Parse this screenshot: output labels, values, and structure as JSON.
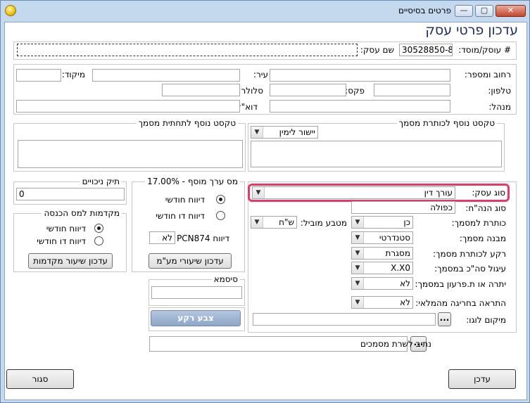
{
  "window": {
    "title": "פרטים בסיסיים",
    "close_glyph": "✕",
    "max_glyph": "▢",
    "min_glyph": "—"
  },
  "header": {
    "title": "עדכון פרטי עסק"
  },
  "business": {
    "id_label": "# עוסק/מוסד:",
    "id_value": "30528850-8",
    "name_label": "שם עסק:",
    "name_value": ""
  },
  "address": {
    "street_label": "רחוב ומספר:",
    "city_label": "עיר:",
    "zip_label": "מיקוד:",
    "phone_label": "טלפון:",
    "fax_label": "פקס:",
    "mobile_label": "סלולר:",
    "manager_label": "מנהל:",
    "email_label": "דוא\"ל:"
  },
  "footer_text": {
    "title": "טקסט נוסף לתחתית מסמך"
  },
  "header_text": {
    "title": "טקסט נוסף לכותרת מסמך",
    "align_value": "יישור לימין"
  },
  "vat": {
    "title": "מס ערך מוסף - 17.00%",
    "monthly_label": "דיווח חודשי",
    "bimonthly_label": "דיווח דו חודשי",
    "pcn_label": "דיווח PCN874",
    "pcn_value": "לא",
    "update_button": "עדכון שיעורי מע\"מ"
  },
  "deductions": {
    "title": "תיק ניכויים",
    "value": "0"
  },
  "advances": {
    "title": "מקדמות למס הכנסה",
    "monthly_label": "דיווח חודשי",
    "bimonthly_label": "דיווח דו חודשי",
    "update_button": "עדכון שיעור מקדמות"
  },
  "password": {
    "title": "סיסמא",
    "value": ""
  },
  "paint_button": "צבע רקע",
  "doc_settings": {
    "business_type_label": "סוג עסק:",
    "business_type_value": "עורך דין",
    "bookkeeping_label": "סוג הנה\"ח:",
    "bookkeeping_value": "כפולה",
    "doc_header_label": "כותרת למסמך:",
    "doc_header_value": "כן",
    "currency_label": "מטבע מוביל:",
    "currency_value": "ש\"ח",
    "doc_structure_label": "מבנה מסמך:",
    "doc_structure_value": "סטנדרטי",
    "header_bg_label": "רקע לכותרת מסמך:",
    "header_bg_value": "מסגרת",
    "rounding_label": "עיגול סה\"כ במסמך:",
    "rounding_value": "X.X0",
    "balance_label": "יתרה או ת.פרעון במסמך:",
    "balance_value": "לא",
    "warning_label": "התראה בחריגה מהמלאי:",
    "warning_value": "לא",
    "logo_label": "מיקום לוגו:",
    "logo_value": "",
    "browse_label": "..."
  },
  "docs_path": {
    "label": "נתיב לשרת מסמכים",
    "value": "",
    "browse_label": "..."
  },
  "actions": {
    "update": "עדכן",
    "close": "סגור"
  }
}
